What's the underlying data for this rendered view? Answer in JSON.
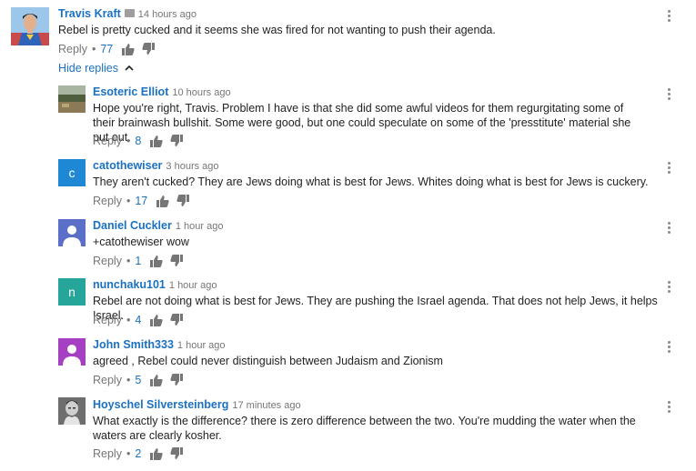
{
  "top_comment": {
    "author": "Travis Kraft",
    "time": "14 hours ago",
    "text": "Rebel is pretty cucked and it seems she was fired for not wanting to push their agenda.",
    "reply_label": "Reply",
    "likes": "77"
  },
  "hide_replies_label": "Hide replies",
  "replies": [
    {
      "author": "Esoteric Elliot",
      "time": "10 hours ago",
      "text": "Hope you're right, Travis. Problem I have is that she did some awful videos for them regurgitating some of their brainwash bullshit. Some were good, but one could speculate on some of the 'presstitute' material she put out.",
      "reply_label": "Reply",
      "likes": "8"
    },
    {
      "author": "catothewiser",
      "time": "3 hours ago",
      "avatar_letter": "c",
      "avatar_color": "#1e88d4",
      "text": "They aren't cucked?  They are Jews doing what is best for Jews.  Whites doing what is best for Jews is cuckery.",
      "reply_label": "Reply",
      "likes": "17"
    },
    {
      "author": "Daniel Cuckler",
      "time": "1 hour ago",
      "avatar_color": "#5b6fc8",
      "text": "+catothewiser wow",
      "reply_label": "Reply",
      "likes": "1"
    },
    {
      "author": "nunchaku101",
      "time": "1 hour ago",
      "avatar_letter": "n",
      "avatar_color": "#26a69a",
      "text": "Rebel are not doing what is best for Jews. They are pushing the Israel agenda. That does not help Jews, it helps Israel.",
      "reply_label": "Reply",
      "likes": "4"
    },
    {
      "author": "John Smith333",
      "time": "1 hour ago",
      "avatar_color": "#a640c3",
      "text": "agreed , Rebel could never distinguish between Judaism and Zionism",
      "reply_label": "Reply",
      "likes": "5"
    },
    {
      "author": "Hoyschel Silversteinberg",
      "time": "17 minutes ago",
      "text": "What exactly is the difference? there is zero difference between the two. You're mudding the water when the waters are clearly kosher.",
      "reply_label": "Reply",
      "likes": "2"
    }
  ],
  "colors": {
    "link_blue": "#1b71c1",
    "meta_gray": "#767676"
  }
}
